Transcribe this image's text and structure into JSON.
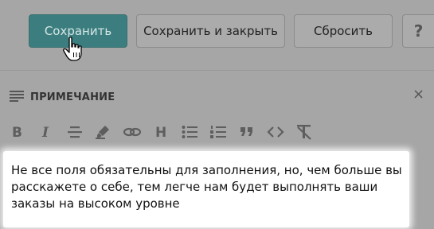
{
  "buttons": {
    "save": "Сохранить",
    "save_close": "Сохранить и закрыть",
    "reset": "Сбросить",
    "help": "?"
  },
  "panel": {
    "title": "ПРИМЕЧАНИЕ",
    "close": "×"
  },
  "toolbar": {
    "icons": [
      "bold-icon",
      "italic-icon",
      "strikethrough-icon",
      "highlight-icon",
      "link-icon",
      "heading-icon",
      "bullet-list-icon",
      "numbered-list-icon",
      "quote-icon",
      "code-icon",
      "clear-format-icon"
    ]
  },
  "editor": {
    "text": "Не все поля обязательны для заполнения, но, чем больше вы расскажете о себе, тем легче нам будет выполнять ваши заказы на высоком уровне"
  },
  "colors": {
    "overlay": "#a6a6a6",
    "primary": "#3c7e7f",
    "editor_bg": "#ffffff"
  }
}
